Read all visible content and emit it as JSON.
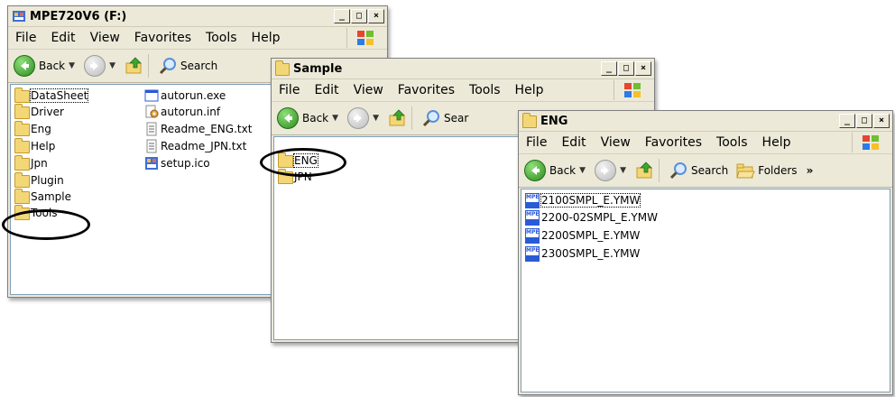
{
  "window1": {
    "title": "MPE720V6 (F:)",
    "menu": [
      "File",
      "Edit",
      "View",
      "Favorites",
      "Tools",
      "Help"
    ],
    "toolbar": {
      "back": "Back",
      "search": "Search"
    },
    "items": [
      {
        "label": "DataSheet",
        "type": "folder"
      },
      {
        "label": "Driver",
        "type": "folder"
      },
      {
        "label": "Eng",
        "type": "folder"
      },
      {
        "label": "Help",
        "type": "folder"
      },
      {
        "label": "Jpn",
        "type": "folder"
      },
      {
        "label": "Plugin",
        "type": "folder"
      },
      {
        "label": "Sample",
        "type": "folder"
      },
      {
        "label": "Tools",
        "type": "folder"
      },
      {
        "label": "autorun.exe",
        "type": "exe"
      },
      {
        "label": "autorun.inf",
        "type": "inf"
      },
      {
        "label": "Readme_ENG.txt",
        "type": "txt"
      },
      {
        "label": "Readme_JPN.txt",
        "type": "txt"
      },
      {
        "label": "setup.ico",
        "type": "ico"
      }
    ]
  },
  "window2": {
    "title": "Sample",
    "menu": [
      "File",
      "Edit",
      "View",
      "Favorites",
      "Tools",
      "Help"
    ],
    "toolbar": {
      "back": "Back",
      "search": "Sear"
    },
    "items": [
      {
        "label": "ENG",
        "type": "folder"
      },
      {
        "label": "JPN",
        "type": "folder"
      }
    ]
  },
  "window3": {
    "title": "ENG",
    "menu": [
      "File",
      "Edit",
      "View",
      "Favorites",
      "Tools",
      "Help"
    ],
    "toolbar": {
      "back": "Back",
      "search": "Search",
      "folders": "Folders",
      "more": "»"
    },
    "items": [
      {
        "label": "2100SMPL_E.YMW",
        "type": "ymw"
      },
      {
        "label": "2200-02SMPL_E.YMW",
        "type": "ymw"
      },
      {
        "label": "2200SMPL_E.YMW",
        "type": "ymw"
      },
      {
        "label": "2300SMPL_E.YMW",
        "type": "ymw"
      }
    ]
  },
  "window_controls": {
    "minimize": "_",
    "maximize": "□",
    "close": "×"
  },
  "colors": {
    "chrome": "#ece9d8",
    "content_bg": "#ffffff",
    "highlight_ellipse": "#000000"
  }
}
